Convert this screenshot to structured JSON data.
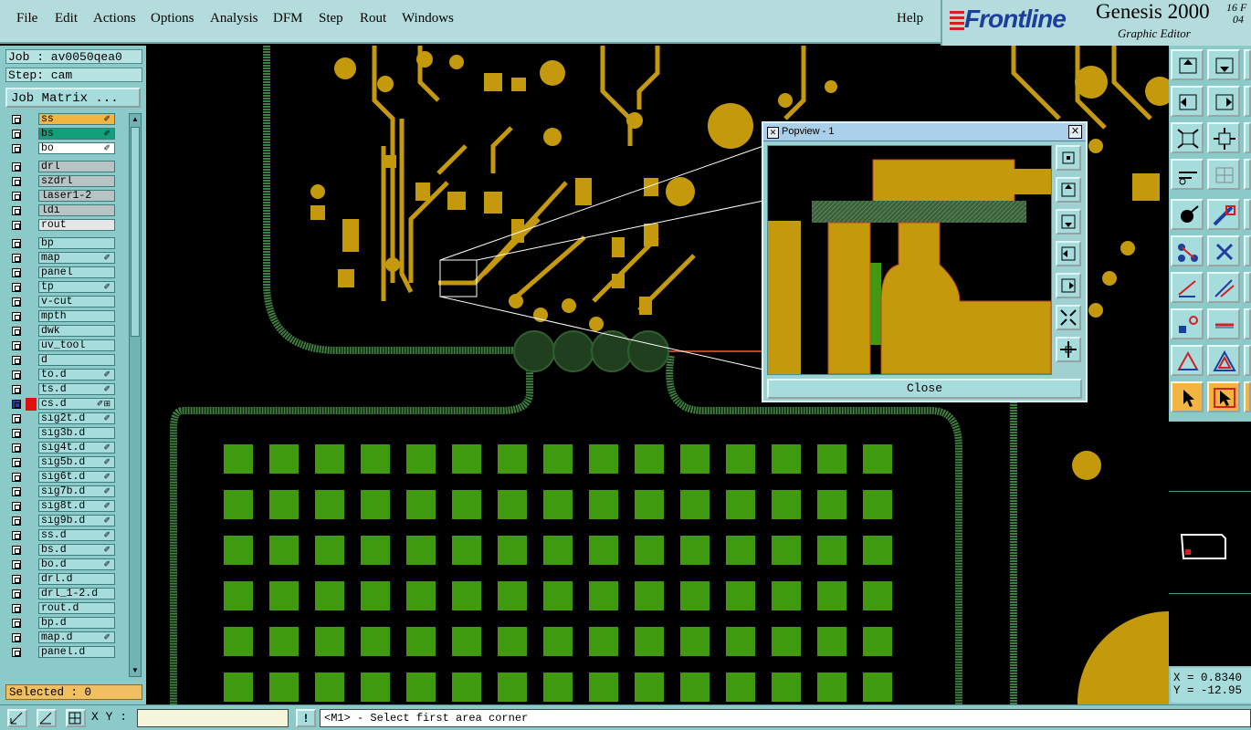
{
  "menubar": {
    "items": [
      "File",
      "Edit",
      "Actions",
      "Options",
      "Analysis",
      "DFM",
      "Step",
      "Rout",
      "Windows"
    ],
    "help": "Help"
  },
  "brand": {
    "logo": "Frontline",
    "product": "Genesis 2000",
    "subtitle": "Graphic Editor",
    "date_top": "16 F",
    "date_bottom": "04"
  },
  "left": {
    "job": "Job : av0050qea0",
    "step": "Step: cam",
    "job_matrix": "Job Matrix ...",
    "selected": "Selected : 0",
    "layers": [
      {
        "name": "ss",
        "color": "#f2b640",
        "icon": "✐"
      },
      {
        "name": "bs",
        "color": "#12a07a",
        "icon": "✐"
      },
      {
        "name": "bo",
        "color": "#ffffff",
        "icon": "✐"
      },
      {
        "name": "drl",
        "color": "#b8c4c4",
        "icon": ""
      },
      {
        "name": "szdrl",
        "color": "#b8c4c4",
        "icon": ""
      },
      {
        "name": "laser1-2",
        "color": "#b8c4c4",
        "icon": ""
      },
      {
        "name": "ldi",
        "color": "#b8c4c4",
        "icon": ""
      },
      {
        "name": "rout",
        "color": "#e6e6e6",
        "icon": ""
      },
      {
        "name": "bp",
        "color": "#a6dcdc",
        "icon": ""
      },
      {
        "name": "map",
        "color": "#a6dcdc",
        "icon": "✐"
      },
      {
        "name": "panel",
        "color": "#a6dcdc",
        "icon": ""
      },
      {
        "name": "tp",
        "color": "#a6dcdc",
        "icon": "✐"
      },
      {
        "name": "v-cut",
        "color": "#a6dcdc",
        "icon": ""
      },
      {
        "name": "mpth",
        "color": "#a6dcdc",
        "icon": ""
      },
      {
        "name": "dwk",
        "color": "#a6dcdc",
        "icon": ""
      },
      {
        "name": "uv_tool",
        "color": "#a6dcdc",
        "icon": ""
      },
      {
        "name": "d",
        "color": "#a6dcdc",
        "icon": ""
      },
      {
        "name": "to.d",
        "color": "#a6dcdc",
        "icon": "✐"
      },
      {
        "name": "ts.d",
        "color": "#a6dcdc",
        "icon": "✐"
      },
      {
        "name": "cs.d",
        "color": "#a6dcdc",
        "icon": "✐⊞"
      },
      {
        "name": "sig2t.d",
        "color": "#a6dcdc",
        "icon": "✐"
      },
      {
        "name": "sig3b.d",
        "color": "#a6dcdc",
        "icon": ""
      },
      {
        "name": "sig4t.d",
        "color": "#a6dcdc",
        "icon": "✐"
      },
      {
        "name": "sig5b.d",
        "color": "#a6dcdc",
        "icon": "✐"
      },
      {
        "name": "sig6t.d",
        "color": "#a6dcdc",
        "icon": "✐"
      },
      {
        "name": "sig7b.d",
        "color": "#a6dcdc",
        "icon": "✐"
      },
      {
        "name": "sig8t.d",
        "color": "#a6dcdc",
        "icon": "✐"
      },
      {
        "name": "sig9b.d",
        "color": "#a6dcdc",
        "icon": "✐"
      },
      {
        "name": "ss.d",
        "color": "#a6dcdc",
        "icon": "✐"
      },
      {
        "name": "bs.d",
        "color": "#a6dcdc",
        "icon": "✐"
      },
      {
        "name": "bo.d",
        "color": "#a6dcdc",
        "icon": "✐"
      },
      {
        "name": "drl.d",
        "color": "#a6dcdc",
        "icon": ""
      },
      {
        "name": "drl_1-2.d",
        "color": "#a6dcdc",
        "icon": ""
      },
      {
        "name": "rout.d",
        "color": "#a6dcdc",
        "icon": ""
      },
      {
        "name": "bp.d",
        "color": "#a6dcdc",
        "icon": ""
      },
      {
        "name": "map.d",
        "color": "#a6dcdc",
        "icon": "✐"
      },
      {
        "name": "panel.d",
        "color": "#a6dcdc",
        "icon": ""
      }
    ]
  },
  "popview": {
    "title": "Popview - 1",
    "close_label": "Close"
  },
  "coords": {
    "x": "X = 0.8340",
    "y": "Y = -12.95"
  },
  "status": {
    "xy_label": "X Y :",
    "xy_value": "",
    "message": "<M1> - Select first area corner"
  },
  "colors": {
    "copper": "#c49a0c",
    "pad_green": "#3f9a0f",
    "panel": "#8ccaca",
    "active_tool": "#f2b640"
  }
}
